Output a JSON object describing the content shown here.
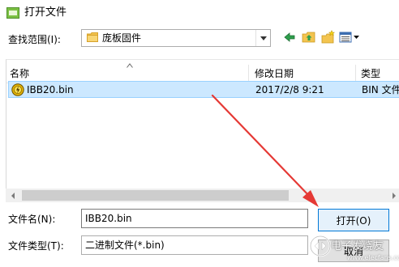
{
  "window": {
    "title": "打开文件"
  },
  "lookin": {
    "label": "查找范围(I):",
    "value": "庞板固件"
  },
  "toolbar": {
    "icons": [
      "back-arrow-icon",
      "up-folder-icon",
      "new-folder-icon",
      "views-menu-icon"
    ]
  },
  "filelist": {
    "columns": {
      "name": "名称",
      "date": "修改日期",
      "type": "类型"
    },
    "rows": [
      {
        "name": "IBB20.bin",
        "date": "2017/2/8 9:21",
        "type": "BIN 文件"
      }
    ]
  },
  "filename": {
    "label": "文件名(N):",
    "value": "IBB20.bin"
  },
  "filetype": {
    "label": "文件类型(T):",
    "value": "二进制文件(*.bin)"
  },
  "buttons": {
    "open": "打开(O)",
    "cancel": "取消"
  },
  "watermark": {
    "text": "电子发烧友",
    "sub": "www.elecfans.com"
  },
  "colors": {
    "selection": "#cce8ff",
    "selection_border": "#99d1ff",
    "arrow": "#e53935",
    "folder": "#f3c44f",
    "default_button_border": "#0078d7"
  }
}
